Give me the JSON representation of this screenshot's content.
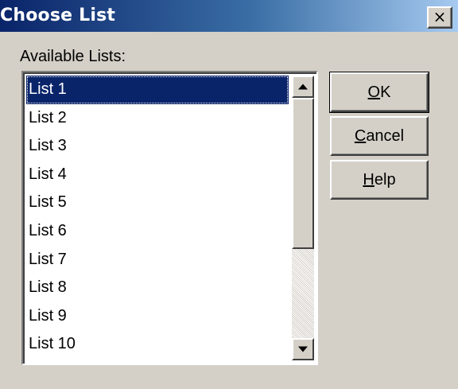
{
  "window": {
    "title": "Choose List",
    "close_glyph": "×"
  },
  "main": {
    "list_label": "Available Lists:",
    "lists": [
      {
        "label": "List 1",
        "selected": true
      },
      {
        "label": "List 2",
        "selected": false
      },
      {
        "label": "List 3",
        "selected": false
      },
      {
        "label": "List 4",
        "selected": false
      },
      {
        "label": "List 5",
        "selected": false
      },
      {
        "label": "List 6",
        "selected": false
      },
      {
        "label": "List 7",
        "selected": false
      },
      {
        "label": "List 8",
        "selected": false
      },
      {
        "label": "List 9",
        "selected": false
      },
      {
        "label": "List 10",
        "selected": false
      }
    ]
  },
  "buttons": {
    "ok": {
      "mnemonic": "O",
      "rest": "K"
    },
    "cancel": {
      "mnemonic": "C",
      "rest": "ancel"
    },
    "help": {
      "mnemonic": "H",
      "rest": "elp"
    }
  },
  "colors": {
    "titlebar_start": "#0a246a",
    "titlebar_end": "#a6caf0",
    "face": "#d4d0c8",
    "selection": "#0a246a"
  },
  "icons": {
    "close": "close-icon",
    "scroll_up": "arrow-up-icon",
    "scroll_down": "arrow-down-icon"
  }
}
